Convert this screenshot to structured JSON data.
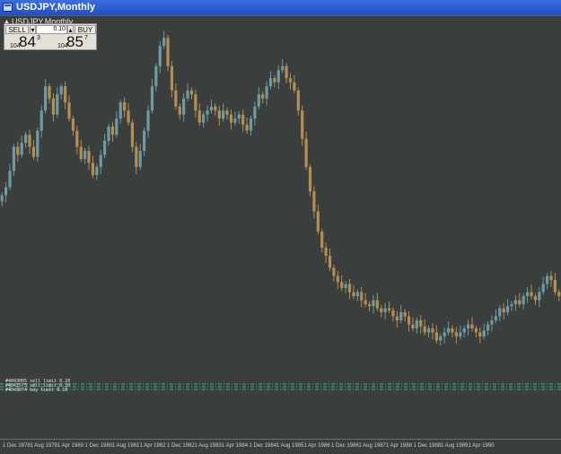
{
  "window": {
    "title": "USDJPY,Monthly"
  },
  "chart": {
    "label": "USDJPY,Monthly"
  },
  "trade_panel": {
    "sell_label": "SELL",
    "buy_label": "BUY",
    "lot_value": "0.10",
    "sell_price": {
      "prefix": "104",
      "big": "84",
      "sup": "3"
    },
    "buy_price": {
      "prefix": "104",
      "big": "85",
      "sup": "7"
    }
  },
  "orders": [
    {
      "label": "#4043005 sell limit 0.10"
    },
    {
      "label": "#4042575 sell limit 0.10"
    },
    {
      "label": "#4043074 buy limit 0.10"
    }
  ],
  "x_axis": {
    "ticks": [
      "1 Dec 1978",
      "1 Aug 1979",
      "1 Apr 1980",
      "1 Dec 1980",
      "1 Aug 1981",
      "1 Apr 1982",
      "1 Dec 1982",
      "1 Aug 1983",
      "1 Apr 1984",
      "1 Dec 1984",
      "1 Aug 1985",
      "1 Apr 1986",
      "1 Dec 1986",
      "1 Aug 1987",
      "1 Apr 1988",
      "1 Dec 1988",
      "1 Aug 1989",
      "1 Apr 1990"
    ]
  },
  "colors": {
    "bull": "#6f9aa2",
    "bear": "#b38f52",
    "background": "#3a3e3c",
    "order_line": "#3fb57a"
  },
  "chart_data": {
    "type": "candlestick",
    "closes": [
      198,
      202,
      210,
      222,
      218,
      224,
      228,
      222,
      217,
      230,
      240,
      252,
      246,
      238,
      248,
      252,
      244,
      236,
      230,
      222,
      216,
      220,
      214,
      208,
      212,
      218,
      225,
      232,
      228,
      236,
      244,
      240,
      234,
      222,
      212,
      220,
      230,
      240,
      252,
      262,
      272,
      276,
      262,
      250,
      242,
      238,
      246,
      250,
      248,
      240,
      234,
      238,
      240,
      242,
      240,
      236,
      240,
      238,
      234,
      236,
      238,
      233,
      230,
      236,
      242,
      248,
      246,
      252,
      256,
      254,
      260,
      262,
      256,
      254,
      250,
      240,
      226,
      212,
      200,
      190,
      180,
      172,
      168,
      162,
      158,
      155,
      152,
      154,
      150,
      148,
      150,
      146,
      144,
      143,
      146,
      142,
      140,
      142,
      141,
      138,
      136,
      140,
      138,
      134,
      132,
      136,
      133,
      130,
      132,
      130,
      126,
      128,
      130,
      132,
      130,
      128,
      130,
      132,
      134,
      132,
      130,
      128,
      131,
      134,
      136,
      138,
      142,
      140,
      143,
      144,
      146,
      144,
      148,
      150,
      148,
      146,
      150,
      154,
      158,
      156,
      150,
      148
    ]
  }
}
